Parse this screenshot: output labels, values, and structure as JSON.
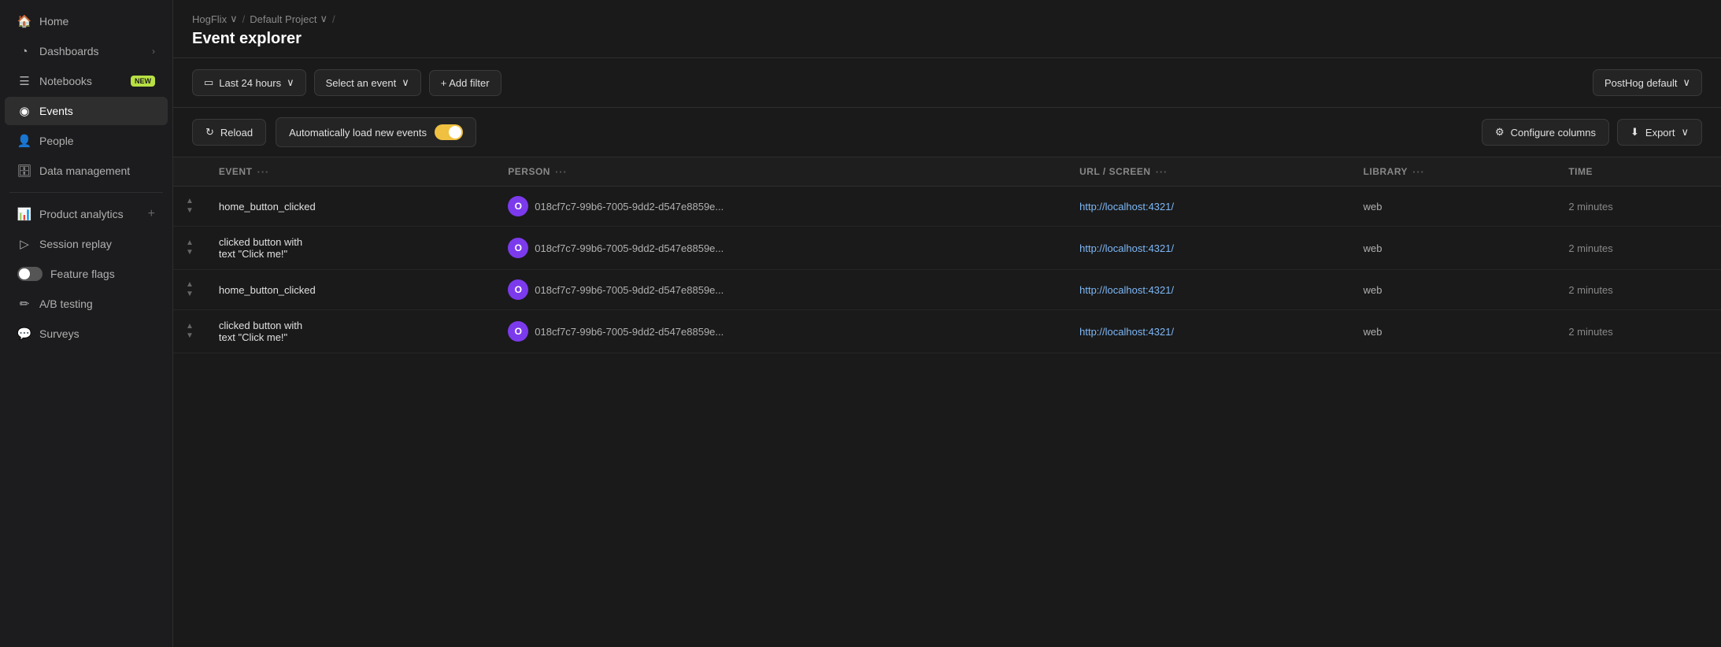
{
  "sidebar": {
    "items": [
      {
        "id": "home",
        "label": "Home",
        "icon": "🏠",
        "active": false
      },
      {
        "id": "dashboards",
        "label": "Dashboards",
        "icon": "⊙",
        "hasChevron": true,
        "active": false
      },
      {
        "id": "notebooks",
        "label": "Notebooks",
        "icon": "📋",
        "badge": "NEW",
        "active": false
      },
      {
        "id": "events",
        "label": "Events",
        "icon": "◉",
        "active": true
      },
      {
        "id": "people",
        "label": "People",
        "icon": "👥",
        "active": false
      },
      {
        "id": "data-management",
        "label": "Data management",
        "icon": "🗄",
        "active": false
      },
      {
        "id": "product-analytics",
        "label": "Product analytics",
        "icon": "📊",
        "hasPlus": true,
        "active": false
      },
      {
        "id": "session-replay",
        "label": "Session replay",
        "icon": "▶",
        "active": false
      },
      {
        "id": "feature-flags",
        "label": "Feature flags",
        "icon": "⚙",
        "hasToggle": true,
        "active": false
      },
      {
        "id": "ab-testing",
        "label": "A/B testing",
        "icon": "✏",
        "active": false
      },
      {
        "id": "surveys",
        "label": "Surveys",
        "icon": "💬",
        "active": false
      }
    ]
  },
  "breadcrumb": {
    "items": [
      {
        "label": "HogFlix",
        "hasChevron": true
      },
      {
        "label": "Default Project",
        "hasChevron": true
      }
    ]
  },
  "page": {
    "title": "Event explorer"
  },
  "toolbar": {
    "time_filter_label": "Last 24 hours",
    "event_select_label": "Select an event",
    "add_filter_label": "+ Add filter",
    "posthog_default_label": "PostHog default"
  },
  "toolbar2": {
    "reload_label": "Reload",
    "auto_load_label": "Automatically load new events",
    "configure_columns_label": "Configure columns",
    "export_label": "Export"
  },
  "table": {
    "columns": [
      {
        "id": "event",
        "label": "EVENT"
      },
      {
        "id": "person",
        "label": "PERSON"
      },
      {
        "id": "url",
        "label": "URL / SCREEN"
      },
      {
        "id": "library",
        "label": "LIBRARY"
      },
      {
        "id": "time",
        "label": "TIME"
      }
    ],
    "rows": [
      {
        "event": "home_button_clicked",
        "avatar_letter": "O",
        "person_id": "018cf7c7-99b6-7005-9dd2-d547e8859e...",
        "url": "http://localhost:4321/",
        "library": "web",
        "time": "2 minutes"
      },
      {
        "event": "clicked button with\ntext \"Click me!\"",
        "avatar_letter": "O",
        "person_id": "018cf7c7-99b6-7005-9dd2-d547e8859e...",
        "url": "http://localhost:4321/",
        "library": "web",
        "time": "2 minutes"
      },
      {
        "event": "home_button_clicked",
        "avatar_letter": "O",
        "person_id": "018cf7c7-99b6-7005-9dd2-d547e8859e...",
        "url": "http://localhost:4321/",
        "library": "web",
        "time": "2 minutes"
      },
      {
        "event": "clicked button with\ntext \"Click me!\"",
        "avatar_letter": "O",
        "person_id": "018cf7c7-99b6-7005-9dd2-d547e8859e...",
        "url": "http://localhost:4321/",
        "library": "web",
        "time": "2 minutes"
      }
    ]
  }
}
